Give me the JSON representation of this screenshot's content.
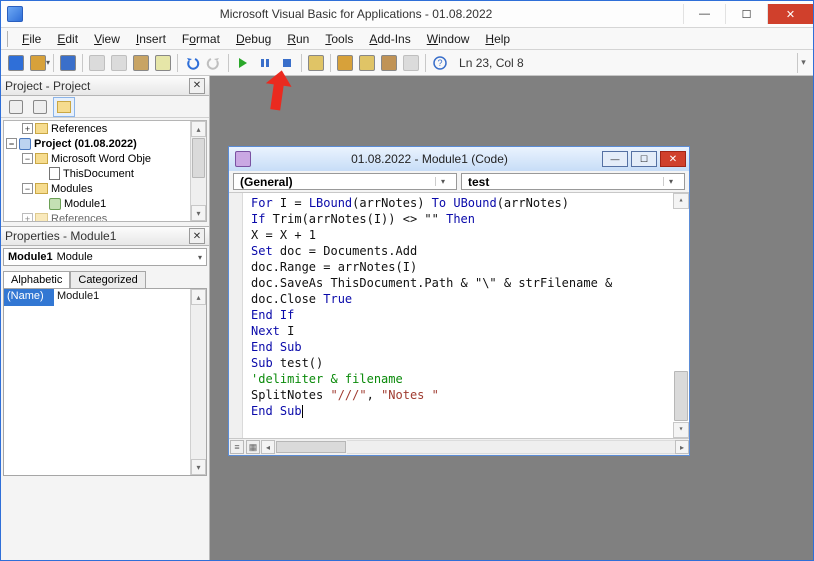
{
  "window": {
    "title": "Microsoft Visual Basic for Applications - 01.08.2022",
    "min": "—",
    "max": "☐",
    "close": "✕"
  },
  "menu": {
    "file": "File",
    "edit": "Edit",
    "view": "View",
    "insert": "Insert",
    "format": "Format",
    "debug": "Debug",
    "run": "Run",
    "tools": "Tools",
    "addins": "Add-Ins",
    "window": "Window",
    "help": "Help"
  },
  "toolbar": {
    "status": "Ln 23, Col 8"
  },
  "project": {
    "title": "Project - Project",
    "nodes": {
      "references": "References",
      "project": "Project (01.08.2022)",
      "wordobj": "Microsoft Word Obje",
      "thisdoc": "ThisDocument",
      "modules": "Modules",
      "module1": "Module1",
      "references2": "References"
    }
  },
  "properties": {
    "title": "Properties - Module1",
    "combo_bold": "Module1",
    "combo_type": "Module",
    "tab_alpha": "Alphabetic",
    "tab_cat": "Categorized",
    "row_name": "(Name)",
    "row_val": "Module1"
  },
  "codewin": {
    "title": "01.08.2022 - Module1 (Code)",
    "dd_left": "(General)",
    "dd_right": "test"
  },
  "code": {
    "l1a": "For",
    "l1b": " I = ",
    "l1c": "LBound",
    "l1d": "(arrNotes) ",
    "l1e": "To",
    "l1f": " ",
    "l1g": "UBound",
    "l1h": "(arrNotes)",
    "l2a": "If",
    "l2b": " Trim(arrNotes(I)) <> ",
    "l2c": "\"\"",
    "l2d": " ",
    "l2e": "Then",
    "l3": "X = X + 1",
    "l4a": "Set",
    "l4b": " doc = Documents.Add",
    "l5": "doc.Range = arrNotes(I)",
    "l6a": "doc.SaveAs ThisDocument.Path & ",
    "l6b": "\"\\\"",
    "l6c": " & strFilename &",
    "l7a": "doc.Close ",
    "l7b": "True",
    "l8": "End If",
    "l9a": "Next",
    "l9b": " I",
    "l10": "End Sub",
    "l11a": "Sub",
    "l11b": " test()",
    "l12": "'delimiter & filename",
    "l13a": "SplitNotes ",
    "l13b": "\"///\"",
    "l13c": ", ",
    "l13d": "\"Notes \"",
    "l14": "End Sub"
  }
}
